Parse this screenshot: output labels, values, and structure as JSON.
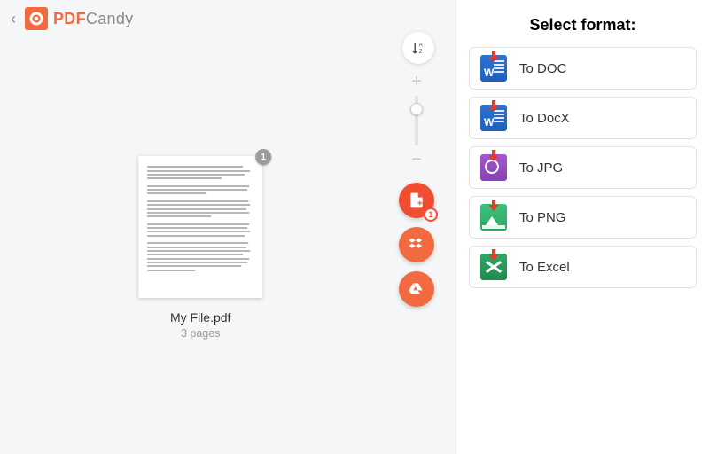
{
  "brand": {
    "pdf": "PDF",
    "candy": "Candy"
  },
  "file": {
    "name": "My File.pdf",
    "meta": "3 pages",
    "page_badge": "1"
  },
  "fab": {
    "add_badge": "1"
  },
  "right": {
    "title": "Select format:",
    "formats": [
      {
        "label": "To DOC"
      },
      {
        "label": "To DocX"
      },
      {
        "label": "To JPG"
      },
      {
        "label": "To PNG"
      },
      {
        "label": "To Excel"
      }
    ]
  }
}
